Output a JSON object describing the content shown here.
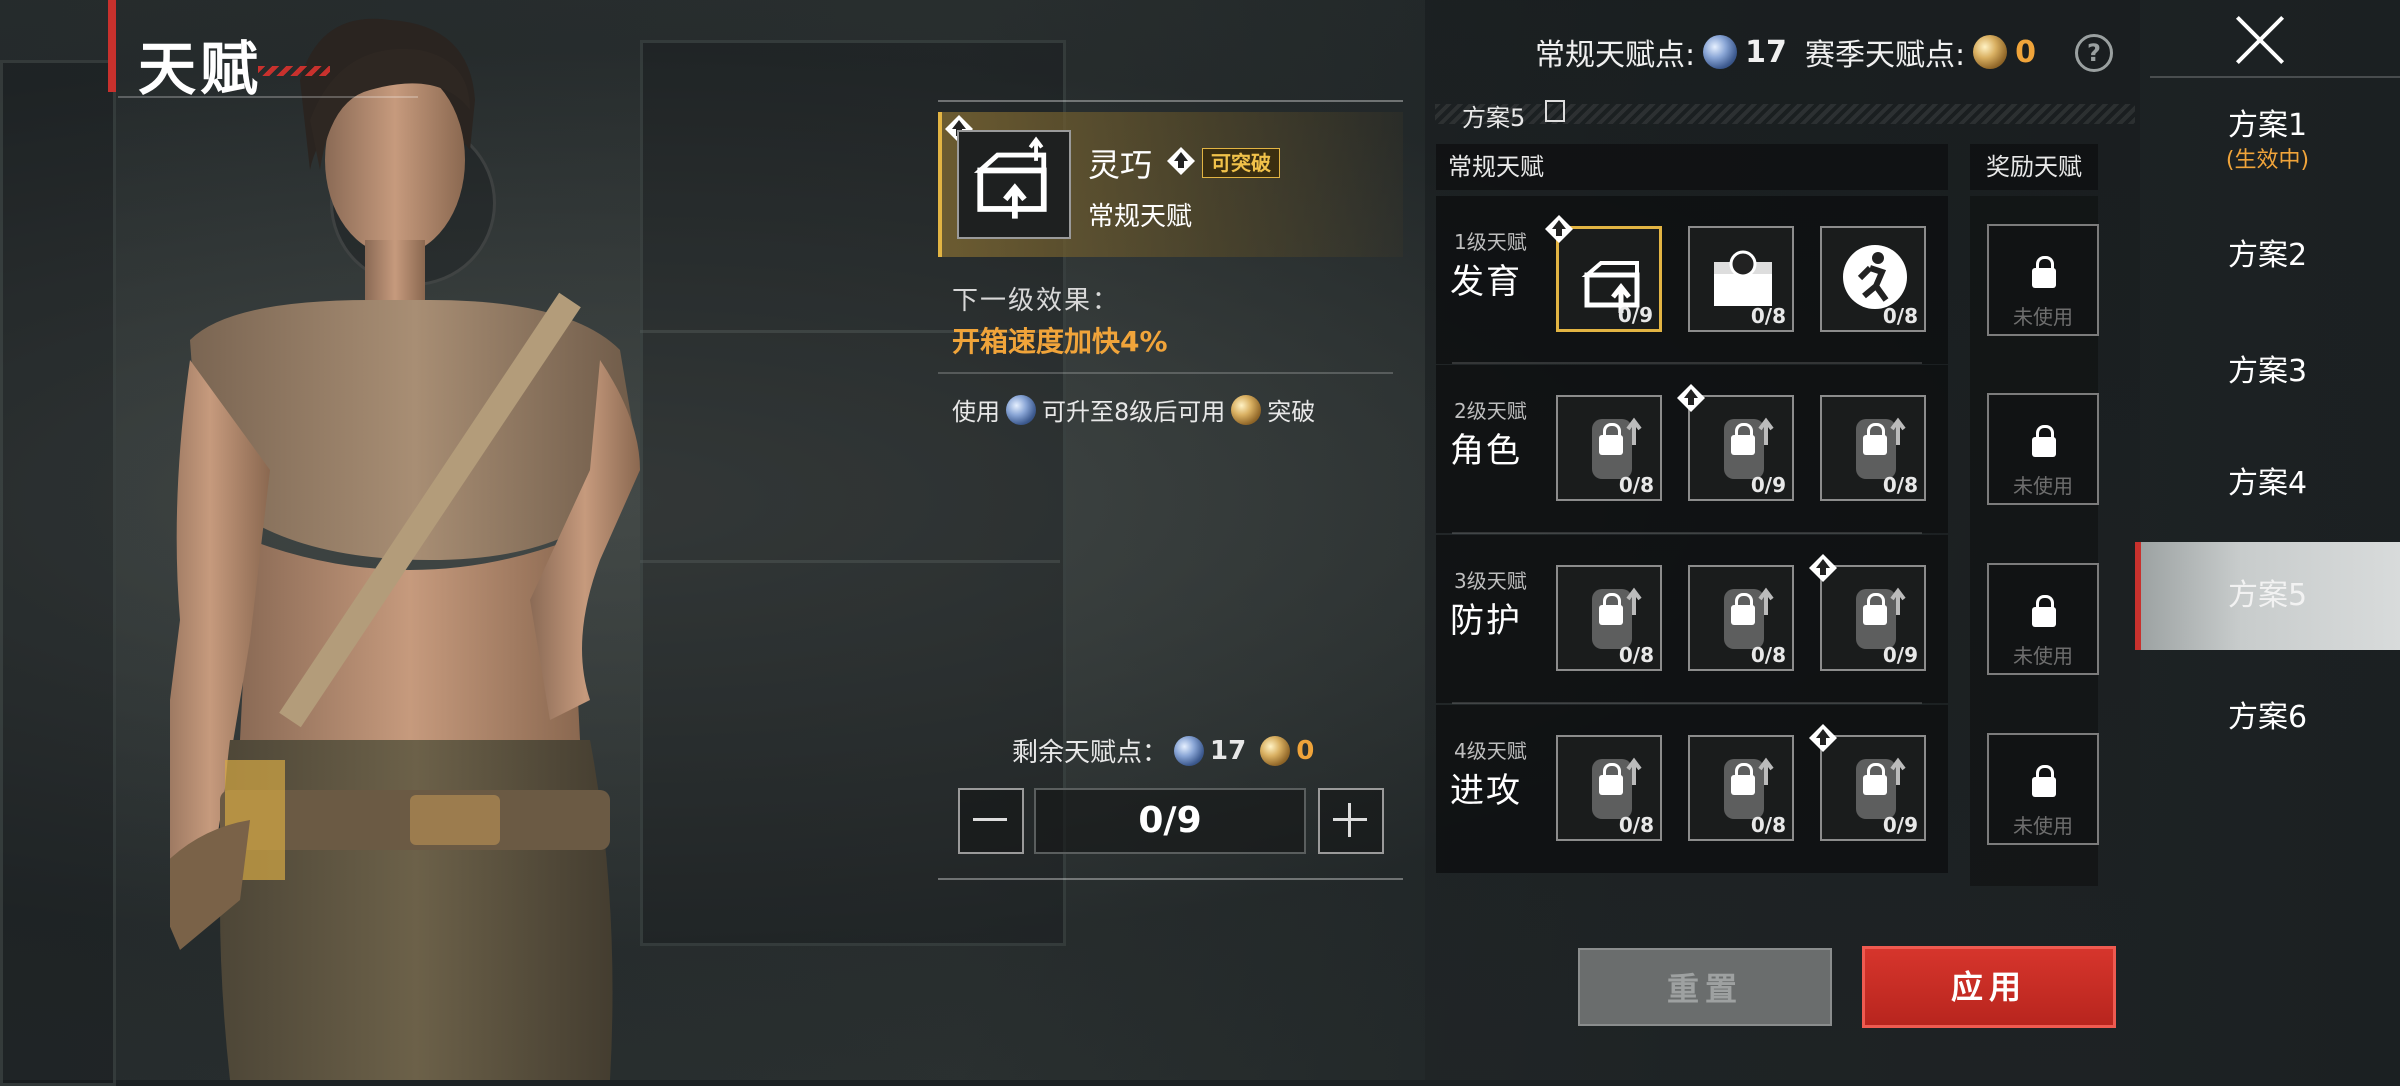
{
  "header": {
    "title": "天赋"
  },
  "currency": {
    "normal_label": "常规天赋点:",
    "normal_value": "17",
    "season_label": "赛季天赋点:",
    "season_value": "0",
    "help": "?"
  },
  "detail": {
    "name": "灵巧",
    "tag": "可突破",
    "category": "常规天赋",
    "next_effect_label": "下一级效果：",
    "next_effect_value": "开箱速度加快4%",
    "usage_prefix": "使用",
    "usage_middle": "可升至8级后可用",
    "usage_suffix": "突破",
    "remaining_label": "剩余天赋点：",
    "remaining_normal": "17",
    "remaining_season": "0",
    "stepper_value": "0/9"
  },
  "tree": {
    "plan_name": "方案5",
    "normal_header": "常规天赋",
    "reward_header": "奖励天赋",
    "tiers": [
      {
        "level": "1级天赋",
        "name": "发育",
        "talents": [
          {
            "icon": "crate-speed-icon",
            "count": "0/9",
            "selected": true,
            "locked": false,
            "breakthrough": true
          },
          {
            "icon": "loot-box-icon",
            "count": "0/8",
            "selected": false,
            "locked": false,
            "breakthrough": false
          },
          {
            "icon": "runner-circle-icon",
            "count": "0/8",
            "selected": false,
            "locked": false,
            "breakthrough": false
          }
        ]
      },
      {
        "level": "2级天赋",
        "name": "角色",
        "talents": [
          {
            "icon": "soldier-sound-icon",
            "count": "0/8",
            "locked": true,
            "breakthrough": false
          },
          {
            "icon": "sprint-up-icon",
            "count": "0/9",
            "locked": true,
            "breakthrough": true
          },
          {
            "icon": "backpack-up-icon",
            "count": "0/8",
            "locked": true,
            "breakthrough": false
          }
        ]
      },
      {
        "level": "3级天赋",
        "name": "防护",
        "talents": [
          {
            "icon": "muscle-up-icon",
            "count": "0/8",
            "locked": true,
            "breakthrough": false
          },
          {
            "icon": "vest-up-icon",
            "count": "0/8",
            "locked": true,
            "breakthrough": false
          },
          {
            "icon": "glove-icon",
            "count": "0/9",
            "locked": true,
            "breakthrough": true
          }
        ]
      },
      {
        "level": "4级天赋",
        "name": "进攻",
        "talents": [
          {
            "icon": "rifle-slash-icon",
            "count": "0/8",
            "locked": true,
            "breakthrough": false
          },
          {
            "icon": "rifle-down-icon",
            "count": "0/8",
            "locked": true,
            "breakthrough": false
          },
          {
            "icon": "shield-gear-icon",
            "count": "0/9",
            "locked": true,
            "breakthrough": true
          }
        ]
      }
    ],
    "reward_slots": [
      {
        "label": "未使用"
      },
      {
        "label": "未使用"
      },
      {
        "label": "未使用"
      },
      {
        "label": "未使用"
      }
    ]
  },
  "actions": {
    "reset": "重置",
    "apply": "应用"
  },
  "plans": [
    {
      "label": "方案1",
      "sub": "(生效中)"
    },
    {
      "label": "方案2"
    },
    {
      "label": "方案3"
    },
    {
      "label": "方案4"
    },
    {
      "label": "方案5",
      "current": true
    },
    {
      "label": "方案6"
    }
  ],
  "colors": {
    "accent_red": "#c8312d",
    "gold": "#e2b443",
    "orange_text": "#f0a43a"
  }
}
